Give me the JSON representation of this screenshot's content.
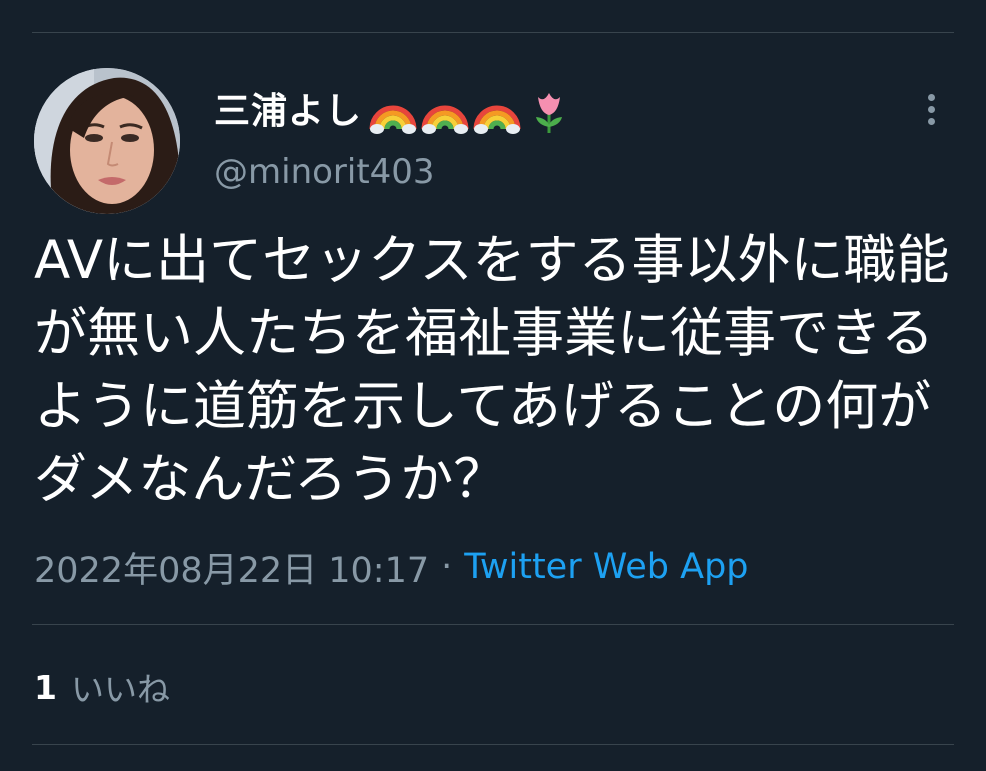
{
  "tweet": {
    "author": {
      "display_name": "三浦よし",
      "name_emojis": [
        "rainbow",
        "rainbow",
        "rainbow",
        "tulip"
      ],
      "handle": "@minorit403"
    },
    "text": "AVに出てセックスをする事以外に職能が無い人たちを福祉事業に従事できるように道筋を示してあげることの何がダメなんだろうか？",
    "timestamp": "2022年08月22日 10:17",
    "separator": "·",
    "source": "Twitter Web App",
    "likes": {
      "count": "1",
      "label": "いいね"
    }
  },
  "colors": {
    "background": "#15202b",
    "divider": "#38444d",
    "primary_text": "#ffffff",
    "secondary_text": "#8899a6",
    "link": "#1da1f2"
  },
  "icons": {
    "more": "more-vertical-icon",
    "avatar": "avatar"
  }
}
